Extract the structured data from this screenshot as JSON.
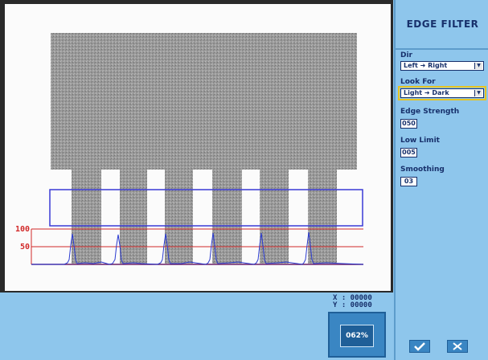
{
  "panel": {
    "title": "EDGE FILTER",
    "dir": {
      "label": "Dir",
      "value": "Left ➜ Right"
    },
    "look_for": {
      "label": "Look For",
      "value": "Light ➜ Dark"
    },
    "edge_strength": {
      "label": "Edge Strength",
      "value": "050"
    },
    "low_limit": {
      "label": "Low Limit",
      "value": "005"
    },
    "smoothing": {
      "label": "Smoothing",
      "value": "03"
    }
  },
  "plot": {
    "label_high": "100",
    "label_low": "50"
  },
  "cursor": {
    "x": "X : 00000",
    "y": "Y : 00000"
  },
  "zoom": {
    "value": "062%"
  },
  "colors": {
    "accent": "#3a86c3",
    "panel_bg": "#8ec6ec",
    "roi_box": "#3b3bd6",
    "threshold_lines": "#d22a2a",
    "highlight": "#e7c421"
  },
  "icons": {
    "ok": "check-icon",
    "cancel": "close-icon",
    "dropdown": "chevron-down-icon"
  }
}
